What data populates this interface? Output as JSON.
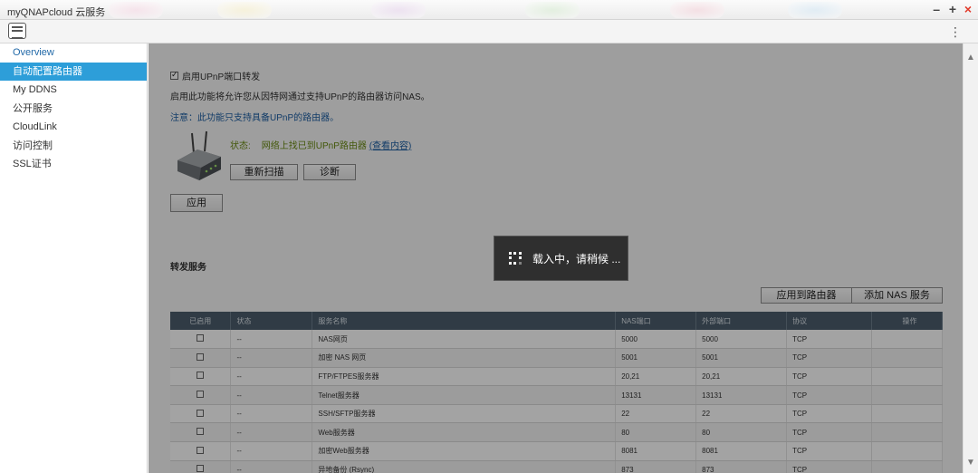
{
  "window": {
    "title": "myQNAPcloud 云服务",
    "controls": [
      "–",
      "+",
      "×"
    ]
  },
  "toolbar": {
    "menu_icon": "kebab-menu-icon"
  },
  "sidebar": {
    "items": [
      {
        "label": "Overview"
      },
      {
        "label": "自动配置路由器"
      },
      {
        "label": "My DDNS"
      },
      {
        "label": "公开服务"
      },
      {
        "label": "CloudLink"
      },
      {
        "label": "访问控制"
      },
      {
        "label": "SSL证书"
      }
    ],
    "active_index": 1
  },
  "upnp": {
    "enable_label": "启用UPnP端口转发",
    "enabled": true,
    "description": "启用此功能将允许您从因特网通过支持UPnP的路由器访问NAS。",
    "note": "注意：此功能只支持具备UPnP的路由器。",
    "status_label": "状态:",
    "status_value": "网络上找已到UPnP路由器",
    "status_link": "(查看内容)",
    "rescan_label": "重新扫描",
    "diagnose_label": "诊断",
    "apply_label": "应用"
  },
  "forwarding": {
    "section_title": "转发服务",
    "apply_router_label": "应用到路由器",
    "add_service_label": "添加 NAS 服务",
    "columns": [
      "已启用",
      "状态",
      "服务名称",
      "NAS端口",
      "外部端口",
      "协议",
      "操作"
    ],
    "rows": [
      {
        "enabled": false,
        "status": "--",
        "name": "NAS网页",
        "nas_port": "5000",
        "ext_port": "5000",
        "protocol": "TCP"
      },
      {
        "enabled": false,
        "status": "--",
        "name": "加密 NAS 网页",
        "nas_port": "5001",
        "ext_port": "5001",
        "protocol": "TCP"
      },
      {
        "enabled": false,
        "status": "--",
        "name": "FTP/FTPES服务器",
        "nas_port": "20,21",
        "ext_port": "20,21",
        "protocol": "TCP"
      },
      {
        "enabled": false,
        "status": "--",
        "name": "Telnet服务器",
        "nas_port": "13131",
        "ext_port": "13131",
        "protocol": "TCP"
      },
      {
        "enabled": false,
        "status": "--",
        "name": "SSH/SFTP服务器",
        "nas_port": "22",
        "ext_port": "22",
        "protocol": "TCP"
      },
      {
        "enabled": false,
        "status": "--",
        "name": "Web服务器",
        "nas_port": "80",
        "ext_port": "80",
        "protocol": "TCP"
      },
      {
        "enabled": false,
        "status": "--",
        "name": "加密Web服务器",
        "nas_port": "8081",
        "ext_port": "8081",
        "protocol": "TCP"
      },
      {
        "enabled": false,
        "status": "--",
        "name": "异地备份 (Rsync)",
        "nas_port": "873",
        "ext_port": "873",
        "protocol": "TCP"
      }
    ]
  },
  "loading": {
    "text": "载入中，请稍候 ..."
  },
  "colors": {
    "accent": "#2d9ed9",
    "table_header": "#4b5d6d",
    "close": "#e23a2a",
    "status_ok": "#6a8a12",
    "link": "#1d5fa3"
  }
}
